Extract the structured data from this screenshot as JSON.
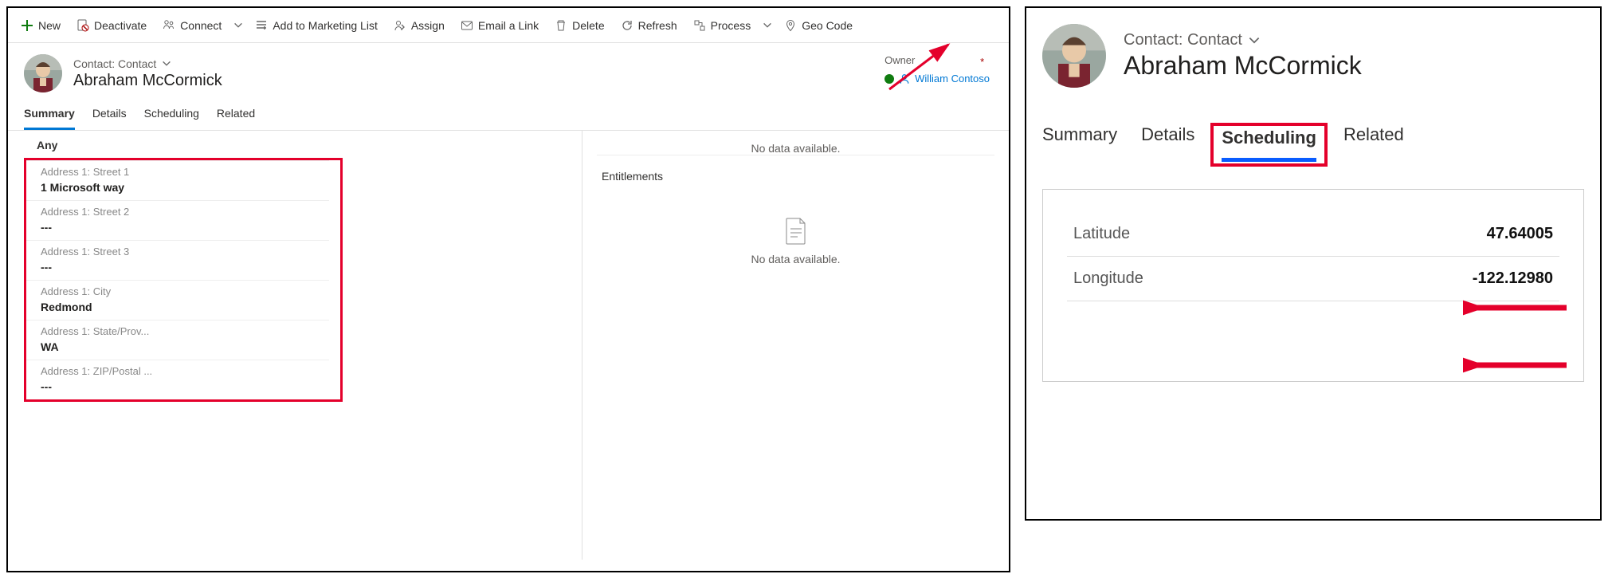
{
  "commands": {
    "new": "New",
    "deactivate": "Deactivate",
    "connect": "Connect",
    "add_marketing": "Add to Marketing List",
    "assign": "Assign",
    "email_link": "Email a Link",
    "delete": "Delete",
    "refresh": "Refresh",
    "process": "Process",
    "geo_code": "Geo Code"
  },
  "header": {
    "crumb": "Contact: Contact",
    "title": "Abraham McCormick",
    "owner_label": "Owner",
    "owner_required": "*",
    "owner_value": "William Contoso"
  },
  "tabs_left": {
    "summary": "Summary",
    "details": "Details",
    "scheduling": "Scheduling",
    "related": "Related",
    "active": "summary"
  },
  "tabs_right": {
    "summary": "Summary",
    "details": "Details",
    "scheduling": "Scheduling",
    "related": "Related",
    "active": "scheduling"
  },
  "address_section": {
    "header": "Any",
    "fields": [
      {
        "label": "Address 1: Street 1",
        "value": "1 Microsoft way"
      },
      {
        "label": "Address 1: Street 2",
        "value": "---"
      },
      {
        "label": "Address 1: Street 3",
        "value": "---"
      },
      {
        "label": "Address 1: City",
        "value": "Redmond"
      },
      {
        "label": "Address 1: State/Prov...",
        "value": "WA"
      },
      {
        "label": "Address 1: ZIP/Postal ...",
        "value": "---"
      }
    ]
  },
  "right_col": {
    "no_data": "No data available.",
    "entitlements": "Entitlements",
    "no_data2": "No data available."
  },
  "scheduling": {
    "latitude_label": "Latitude",
    "latitude_value": "47.64005",
    "longitude_label": "Longitude",
    "longitude_value": "-122.12980"
  }
}
